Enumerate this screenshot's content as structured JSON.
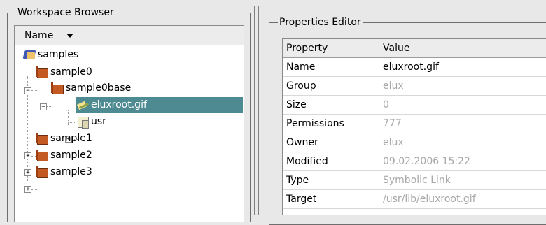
{
  "workspace_browser": {
    "title": "Workspace Browser",
    "column_header": "Name",
    "tree": [
      {
        "label": "samples",
        "icon": "folder-blue-icon"
      },
      {
        "label": "sample0",
        "icon": "cabinet-icon"
      },
      {
        "label": "sample0base",
        "icon": "cabinet-icon"
      },
      {
        "label": "eluxroot.gif",
        "icon": "symlink-icon",
        "selected": true
      },
      {
        "label": "usr",
        "icon": "folder-icon"
      },
      {
        "label": "sample1",
        "icon": "cabinet-icon"
      },
      {
        "label": "sample2",
        "icon": "cabinet-icon"
      },
      {
        "label": "sample3",
        "icon": "cabinet-icon"
      }
    ],
    "expanders": {
      "expanded": "−",
      "collapsed": "+"
    }
  },
  "properties_editor": {
    "title": "Properties Editor",
    "columns": [
      "Property",
      "Value"
    ],
    "rows": [
      {
        "property": "Name",
        "value": "eluxroot.gif"
      },
      {
        "property": "Group",
        "value": "elux"
      },
      {
        "property": "Size",
        "value": "0"
      },
      {
        "property": "Permissions",
        "value": "777"
      },
      {
        "property": "Owner",
        "value": "elux"
      },
      {
        "property": "Modified",
        "value": "09.02.2006 15:22"
      },
      {
        "property": "Type",
        "value": "Symbolic Link"
      },
      {
        "property": "Target",
        "value": "/usr/lib/eluxroot.gif"
      }
    ]
  },
  "colors": {
    "selection": "#4d8a91",
    "background": "#e8e8e8",
    "disabled_value": "#a8a8a8"
  }
}
